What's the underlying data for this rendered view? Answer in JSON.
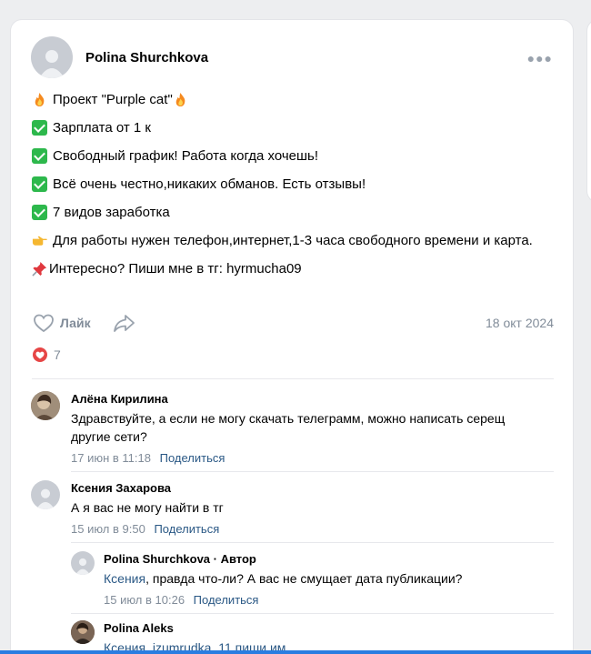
{
  "post": {
    "author": "Polina Shurchkova",
    "lines": [
      {
        "emoji": "fire",
        "text": "Проект \"Purple cat\"",
        "trailing_emoji": "fire"
      },
      {
        "emoji": "check",
        "text": "Зарплата от 1 к"
      },
      {
        "emoji": "check",
        "text": "Свободный график! Работа когда хочешь!"
      },
      {
        "emoji": "check",
        "text": "Всё очень честно,никаких обманов. Есть отзывы!"
      },
      {
        "emoji": "check",
        "text": "7 видов заработка"
      },
      {
        "emoji": "point-right",
        "text": "Для работы нужен телефон,интернет,1-3 часа свободного времени и карта."
      },
      {
        "emoji": "pushpin",
        "text": "Интересно? Пиши мне в тг: hyrmucha09"
      }
    ],
    "like_label": "Лайк",
    "date": "18 окт 2024",
    "reactions_count": "7"
  },
  "comments": [
    {
      "author": "Алёна Кирилина",
      "text": "Здравствуйте, а если не могу скачать телеграмм, можно написать серещ другие сети?",
      "time": "17 июн в 11:18",
      "share_label": "Поделиться"
    },
    {
      "author": "Ксения Захарова",
      "text": "А я вас не могу найти в тг",
      "time": "15 июл в 9:50",
      "share_label": "Поделиться"
    }
  ],
  "replies": [
    {
      "author": "Polina Shurchkova · Автор",
      "mention": "Ксения",
      "text": ", правда что-ли? А вас не смущает дата публикации?",
      "time": "15 июл в 10:26",
      "share_label": "Поделиться"
    },
    {
      "author": "Polina Aleks",
      "mention": "Ксения",
      "text": ", izumrudka_11 пиши им"
    }
  ],
  "colors": {
    "accent": "#2a5885",
    "muted": "#818c99",
    "heart": "#e64646",
    "check": "#2db84c"
  }
}
